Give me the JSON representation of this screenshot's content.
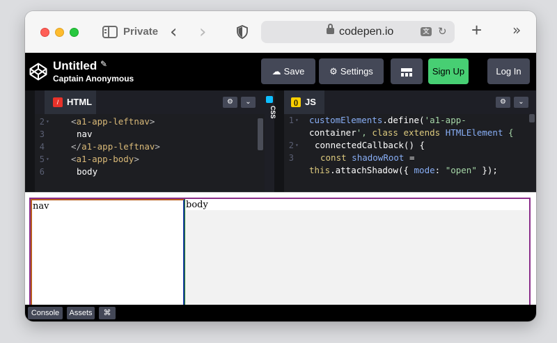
{
  "browser": {
    "private_label": "Private",
    "url": "codepen.io",
    "back_symbol": "‹",
    "forward_symbol": "›",
    "new_tab_symbol": "+",
    "overflow_symbol": "»",
    "reload_symbol": "↻",
    "translate_symbol": "文"
  },
  "header": {
    "title": "Untitled",
    "author": "Captain Anonymous",
    "pencil_symbol": "✎",
    "buttons": {
      "save": "Save",
      "settings": "Settings",
      "signup": "Sign Up",
      "login": "Log In"
    },
    "icons": {
      "save": "☁",
      "settings": "⚙"
    },
    "colors": {
      "signup_bg": "#47cf73",
      "button_bg": "#444857"
    }
  },
  "html_editor": {
    "tab_label": "HTML",
    "tab_icon_glyph": "/",
    "gear_symbol": "⚙",
    "chevron_symbol": "⌄",
    "lines": [
      {
        "num": "2",
        "fold": "▾",
        "text": "<a1-app-leftnav>"
      },
      {
        "num": "3",
        "fold": "",
        "text": "nav"
      },
      {
        "num": "4",
        "fold": "",
        "text": "</a1-app-leftnav>"
      },
      {
        "num": "5",
        "fold": "▾",
        "text": "<a1-app-body>"
      },
      {
        "num": "6",
        "fold": "",
        "text": "body"
      }
    ]
  },
  "css_editor": {
    "tab_label": "CSS"
  },
  "js_editor": {
    "tab_label": "JS",
    "tab_icon_glyph": "()",
    "gear_symbol": "⚙",
    "chevron_symbol": "⌄",
    "lines": [
      {
        "num": "1",
        "fold": "▾",
        "text": "customElements.define('a1-app-"
      },
      {
        "num": "",
        "fold": "",
        "text": "container', class extends HTMLElement {"
      },
      {
        "num": "2",
        "fold": "▾",
        "text": "connectedCallback() {"
      },
      {
        "num": "3",
        "fold": "",
        "text": "const shadowRoot ="
      },
      {
        "num": "",
        "fold": "",
        "text": "this.attachShadow({ mode: \"open\" });"
      }
    ]
  },
  "preview": {
    "nav_text": "nav",
    "body_text": "body"
  },
  "console_bar": {
    "console": "Console",
    "assets": "Assets",
    "shortcuts": "⌘"
  }
}
